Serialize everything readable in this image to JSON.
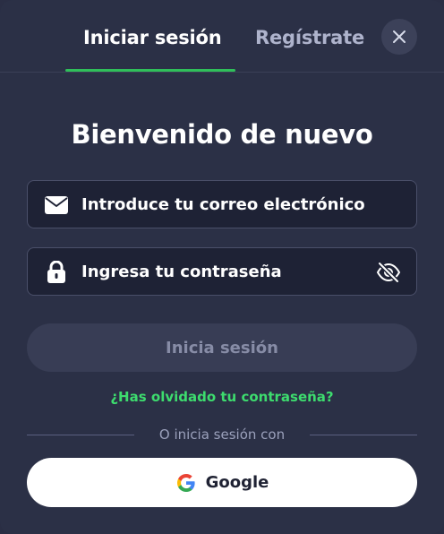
{
  "tabs": {
    "login_label": "Iniciar sesión",
    "register_label": "Regístrate",
    "active": "login"
  },
  "title": "Bienvenido de nuevo",
  "email": {
    "placeholder": "Introduce tu correo electrónico",
    "value": "",
    "icon": "envelope-icon"
  },
  "password": {
    "placeholder": "Ingresa tu contraseña",
    "value": "",
    "icon": "lock-icon",
    "toggle_icon": "eye-slash-icon"
  },
  "submit_label": "Inicia sesión",
  "forgot_label": "¿Has olvidado tu contraseña?",
  "divider_label": "O inicia sesión con",
  "google_label": "Google",
  "colors": {
    "background": "#2b3046",
    "accent": "#2fbf5a",
    "link": "#3ddc6e",
    "field_bg": "#1e2235",
    "disabled_button": "#383d55"
  }
}
